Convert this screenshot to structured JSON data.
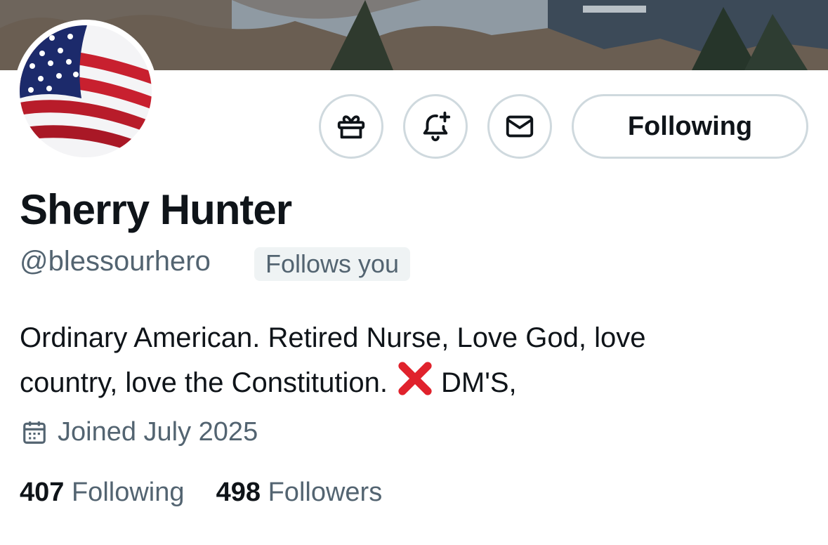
{
  "profile": {
    "name": "Sherry Hunter",
    "handle": "@blessourhero",
    "follows_you": "Follows you",
    "bio_line1": "Ordinary American. Retired Nurse, Love God, love",
    "bio_line2_a": "country, love the Constitution.",
    "bio_emoji": "cross-mark-emoji",
    "bio_line2_b": "DM'S,",
    "joined": "Joined July 2025"
  },
  "actions": {
    "gift_icon": "gift-icon",
    "notify_icon": "bell-plus-icon",
    "message_icon": "envelope-icon",
    "follow_label": "Following"
  },
  "stats": {
    "following_count": "407",
    "following_label": "Following",
    "followers_count": "498",
    "followers_label": "Followers"
  },
  "colors": {
    "text_primary": "#0f1419",
    "text_secondary": "#536471",
    "button_border": "#cfd9de",
    "badge_bg": "#eff3f4"
  }
}
